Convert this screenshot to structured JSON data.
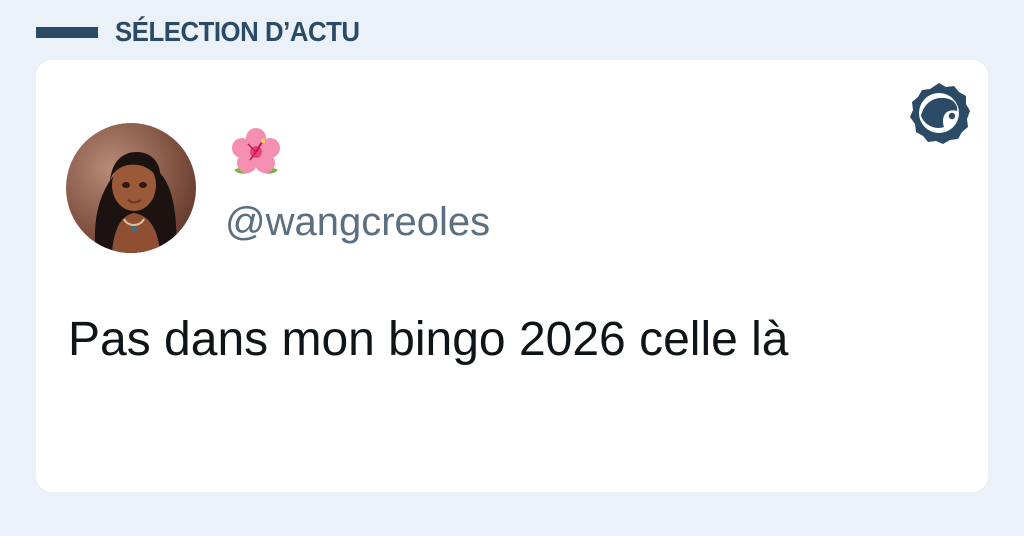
{
  "header": {
    "title": "SÉLECTION D’ACTU"
  },
  "card": {
    "logo_icon": "brand-face-logo-icon",
    "avatar_icon": "user-avatar",
    "display_name_icon": "hibiscus-flower-emoji",
    "handle": "@wangcreoles",
    "text": "Pas dans mon bingo 2026 celle là"
  },
  "colors": {
    "background": "#eaf1f8",
    "brand": "#2b4a66",
    "card": "#ffffff",
    "handle": "#5b6f80",
    "text": "#0f1419"
  }
}
